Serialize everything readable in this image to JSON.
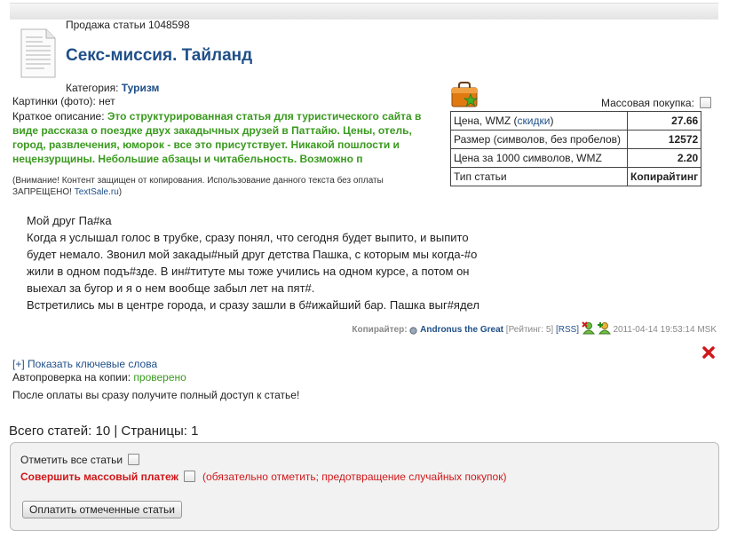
{
  "header": {
    "sale_label": "Продажа статьи 1048598"
  },
  "article": {
    "title": "Секс-миссия. Тайланд",
    "category_label": "Категория:",
    "category_value": "Туризм",
    "images_label": "Картинки (фото):",
    "images_value": "нет",
    "desc_label": "Краткое описание:",
    "desc_text": "Это структурированная статья для туристического сайта в виде рассказа о поездке двух закадычных друзей в Паттайю. Цены, отель, город, развлечения, юморок - все это присутствует. Никакой пошлости и нецензурщины. Небольшие абзацы и читабельность. Возможно п",
    "warning_text": "(Внимание! Контент защищен от копирования. Использование данного текста без оплаты ЗАПРЕЩЕНО!",
    "warning_link": "TextSale.ru",
    "warning_close": ")",
    "excerpt": [
      "Мой друг Па#ка",
      "Когда я услышал голос в трубке, сразу понял, что сегодня будет выпито, и выпито будет немало. Звонил мой закады#ный друг детства Пашка, с которым мы когда-#о жили в одном подъ#зде. В ин#титуте мы тоже учились на одном курсе, а потом он выехал за бугор и я о нем вообще забыл лет на пят#.",
      "Встретились мы в центре города, и сразу зашли в б#ижайший бар. Пашка выг#ядел"
    ]
  },
  "purchase": {
    "mass_label": "Массовая покупка:",
    "rows": [
      {
        "label": "Цена, WMZ (",
        "link": "скидки",
        "label_end": ")",
        "value": "27.66"
      },
      {
        "label": "Размер (символов, без пробелов)",
        "value": "12572"
      },
      {
        "label": "Цена за 1000 символов, WMZ",
        "value": "2.20"
      },
      {
        "label": "Тип статьи",
        "value": "Копирайтинг"
      }
    ]
  },
  "copywriter": {
    "label": "Копирайтер:",
    "name": "Andronus the Great",
    "rating": "[Рейтинг: 5]",
    "rss": "[RSS]",
    "date": "2011-04-14 19:53:14 MSK"
  },
  "keywords": {
    "link": "[+] Показать ключевые слова"
  },
  "autocheck": {
    "label": "Автопроверка на копии:",
    "value": "проверено"
  },
  "after_payment": "После оплаты вы сразу получите полный доступ к статье!",
  "summary": "Всего статей: 10 | Страницы: 1",
  "bulk": {
    "select_all": "Отметить все статьи",
    "mass_payment": "Совершить массовый платеж",
    "mass_note": "(обязательно отметить; предотвращение случайных покупок)",
    "pay_button": "Оплатить отмеченные статьи"
  },
  "colors": {
    "title": "#1f4f88",
    "green": "#3a9a1f",
    "red": "#d0181b"
  }
}
